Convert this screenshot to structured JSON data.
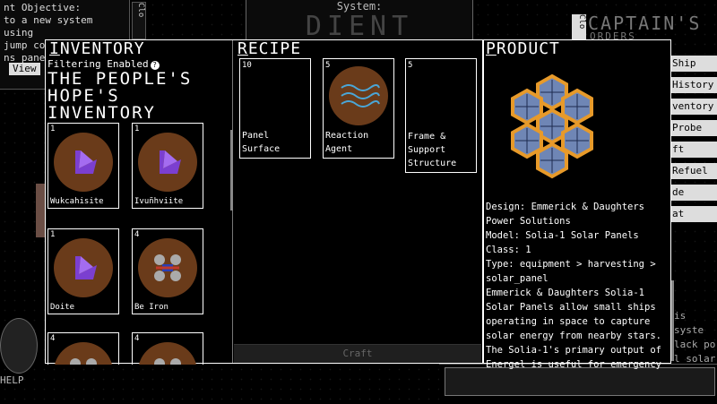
{
  "background": {
    "objective_title": "nt Objective:",
    "objective_lines": [
      "to a new system using",
      "jump comp",
      "ns panel"
    ],
    "view_label": "View",
    "close_label_left": "Clo",
    "system_label": "System:",
    "system_name": "DIENT",
    "captain_label": "CAPTAIN'S",
    "captain_sub": "ORDERS",
    "close_label_right": "Clo",
    "captain_menu": [
      "Ship",
      "History",
      "ventory",
      "Probe",
      "ft",
      "Refuel",
      "de",
      "at"
    ],
    "right_text": [
      "is syste",
      "lack po",
      "l solar"
    ],
    "help_label": "HELP"
  },
  "inventory": {
    "heading": "INVENTORY",
    "filter_label": "Filtering Enabled",
    "title_line1": "THE PEOPLE'S",
    "title_line2": "HOPE'S",
    "title_line3": "INVENTORY",
    "items": [
      {
        "count": "1",
        "name": "Wukcahisite",
        "icon": "crystal-icon"
      },
      {
        "count": "1",
        "name": "Ivuñhviite",
        "icon": "crystal-icon"
      },
      {
        "count": "1",
        "name": "Doite",
        "icon": "crystal-icon"
      },
      {
        "count": "4",
        "name": "Be Iron",
        "icon": "molecule-icon"
      },
      {
        "count": "4",
        "name": "",
        "icon": "molecule-icon"
      },
      {
        "count": "4",
        "name": "",
        "icon": "molecule-icon"
      }
    ]
  },
  "recipe": {
    "heading": "RECIPE",
    "items": [
      {
        "count": "10",
        "name_line1": "Panel",
        "name_line2": "Surface",
        "name_line3": ""
      },
      {
        "count": "5",
        "name_line1": "Reaction",
        "name_line2": "Agent",
        "name_line3": ""
      },
      {
        "count": "5",
        "name_line1": "Frame &",
        "name_line2": "Support",
        "name_line3": "Structure"
      }
    ],
    "craft_label": "Craft"
  },
  "product": {
    "heading": "PRODUCT",
    "lines": [
      "Design: Emmerick & Daughters",
      "Power Solutions",
      "Model: Solia-1 Solar Panels",
      "Class: 1",
      "Type: equipment > harvesting >",
      "solar_panel",
      "Emmerick & Daughters Solia-1",
      "Solar Panels allow small ships",
      "operating in space to capture",
      "solar energy from nearby stars.",
      "The Solia-1's primary output of",
      "Energel is useful for emergency"
    ]
  },
  "colors": {
    "orb": "#6a3b1a",
    "crystal": "#7b3fd0",
    "hex_gold": "#e79a2a",
    "hex_panel": "#6f86b5"
  }
}
